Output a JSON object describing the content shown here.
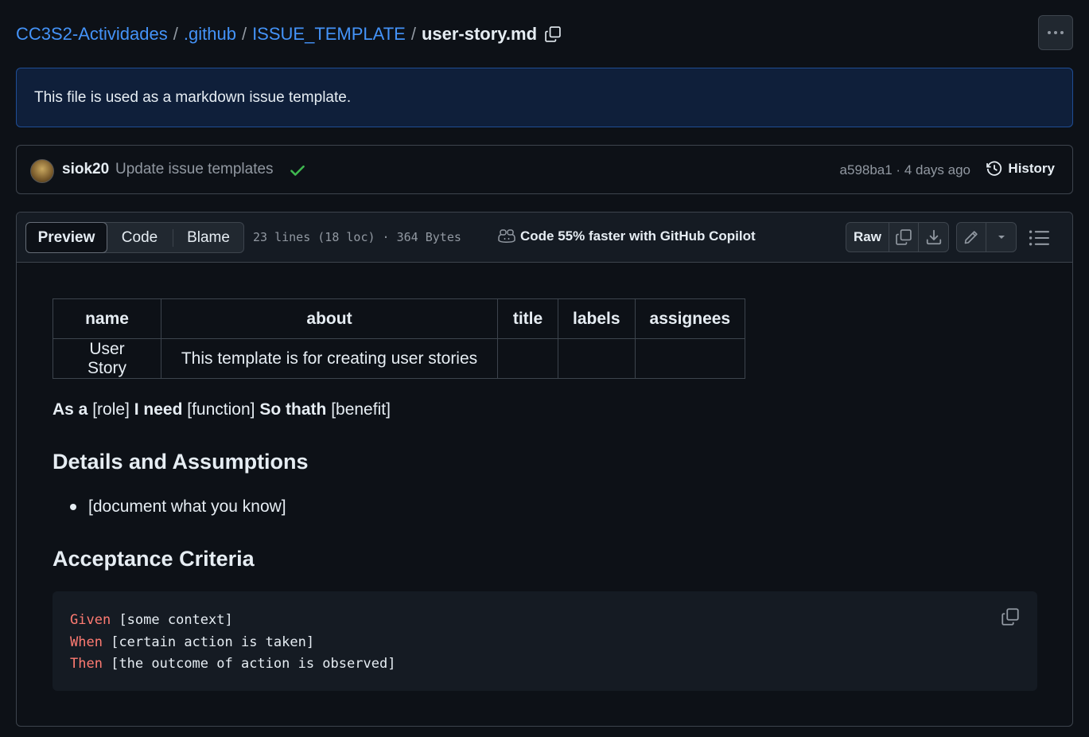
{
  "breadcrumb": {
    "repo": "CC3S2-Actividades",
    "dir1": ".github",
    "dir2": "ISSUE_TEMPLATE",
    "file": "user-story.md",
    "sep": "/"
  },
  "flash": {
    "text": "This file is used as a markdown issue template."
  },
  "commit": {
    "user": "siok20",
    "message": "Update issue templates",
    "meta": "a598ba1 · 4 days ago",
    "history_label": "History",
    "status": "success"
  },
  "file_header": {
    "tabs": [
      "Preview",
      "Code",
      "Blame"
    ],
    "active_tab": "Preview",
    "info": "23 lines (18 loc) · 364 Bytes",
    "copilot": "Code 55% faster with GitHub Copilot",
    "raw_label": "Raw"
  },
  "table": {
    "headers": [
      "name",
      "about",
      "title",
      "labels",
      "assignees"
    ],
    "rows": [
      [
        "User Story",
        "This template is for creating user stories",
        "",
        "",
        ""
      ]
    ]
  },
  "story": {
    "as_a": "As a",
    "role": "[role]",
    "i_need": "I need",
    "function": "[function]",
    "so_thath": "So thath",
    "benefit": "[benefit]"
  },
  "details": {
    "heading": "Details and Assumptions",
    "bullets": [
      "[document what you know]"
    ]
  },
  "acceptance": {
    "heading": "Acceptance Criteria",
    "lines": [
      {
        "keyword": "Given",
        "text": "[some context]"
      },
      {
        "keyword": "When",
        "text": "[certain action is taken]"
      },
      {
        "keyword": "Then",
        "text": "[the outcome of action is observed]"
      }
    ]
  },
  "colors": {
    "background": "#0d1117",
    "link": "#4493f8",
    "muted": "#9198a1",
    "success": "#3fb950",
    "keyword": "#ff7b72",
    "border": "#3d444d"
  },
  "icons": [
    "copy-icon",
    "kebab-icon",
    "check-icon",
    "history-icon",
    "copilot-icon",
    "download-icon",
    "pencil-icon",
    "triangle-down-icon",
    "list-unordered-icon"
  ]
}
